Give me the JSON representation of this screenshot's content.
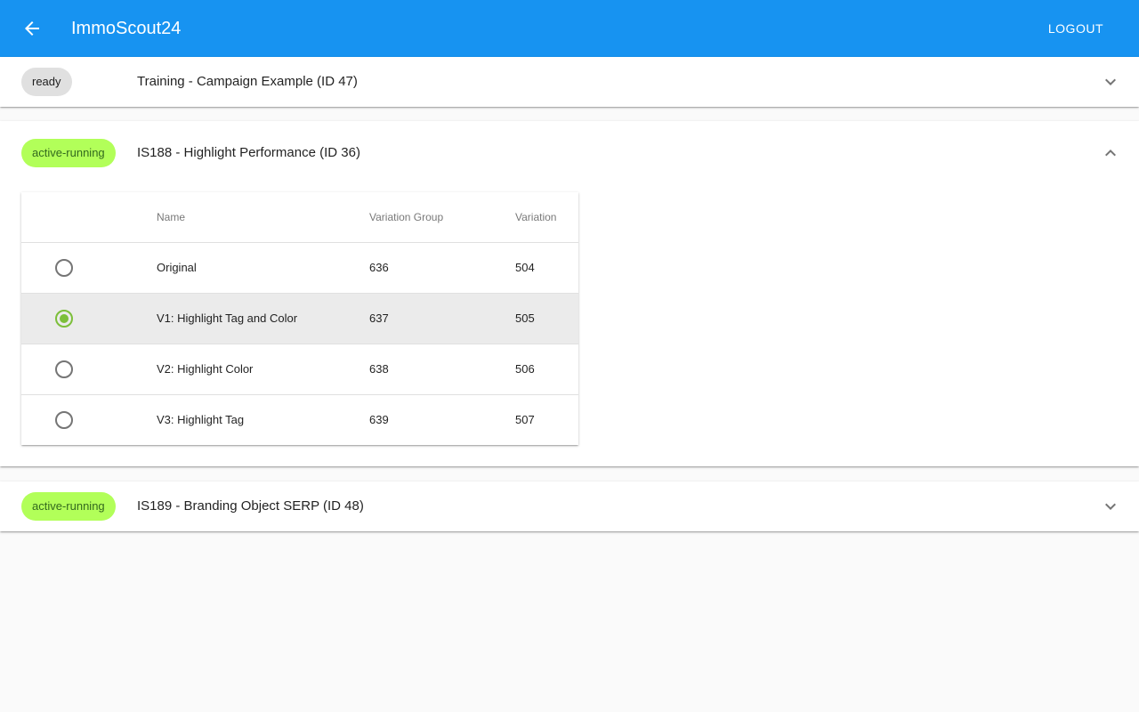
{
  "app": {
    "title": "ImmoScout24",
    "logout_label": "LOGOUT",
    "back_icon": "arrow-left-icon",
    "brand_color": "#1793f1"
  },
  "campaigns": [
    {
      "status": "ready",
      "title": "Training - Campaign Example (ID 47)",
      "expanded": false
    },
    {
      "status": "active-running",
      "title": "IS188 - Highlight Performance (ID 36)",
      "expanded": true,
      "table": {
        "headers": [
          "Name",
          "Variation Group",
          "Variation"
        ],
        "rows": [
          {
            "name": "Original",
            "group": "636",
            "variation": "504",
            "selected": false
          },
          {
            "name": "V1: Highlight Tag and Color",
            "group": "637",
            "variation": "505",
            "selected": true
          },
          {
            "name": "V2: Highlight Color",
            "group": "638",
            "variation": "506",
            "selected": false
          },
          {
            "name": "V3: Highlight Tag",
            "group": "639",
            "variation": "507",
            "selected": false
          }
        ]
      }
    },
    {
      "status": "active-running",
      "title": "IS189 - Branding Object SERP (ID 48)",
      "expanded": false
    }
  ],
  "colors": {
    "ready_chip": "#e0e0e0",
    "active_chip": "#b2ff59",
    "radio_checked": "#7cbf3a"
  }
}
